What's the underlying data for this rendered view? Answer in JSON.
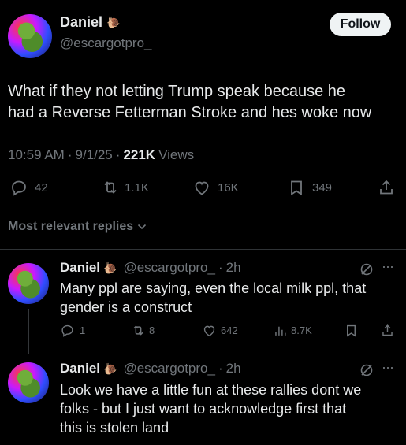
{
  "main_post": {
    "author": {
      "name": "Daniel",
      "badge_icon": "snail-emoji",
      "handle": "@escargotpro_"
    },
    "follow_label": "Follow",
    "text_line1": "What if they not letting Trump speak because he",
    "text_line2": "had a Reverse Fetterman Stroke and hes woke now",
    "meta": {
      "time": "10:59 AM",
      "date": "9/1/25",
      "views_count": "221K",
      "views_label": "Views"
    },
    "actions": {
      "replies": "42",
      "reposts": "1.1K",
      "likes": "16K",
      "bookmarks": "349"
    }
  },
  "sort": {
    "label": "Most relevant replies"
  },
  "replies": [
    {
      "name": "Daniel",
      "handle": "@escargotpro_",
      "dot": "·",
      "time": "2h",
      "line1": "Many ppl are saying, even the local milk ppl, that",
      "line2": "gender is a construct",
      "replies": "1",
      "reposts": "8",
      "likes": "642",
      "views": "8.7K"
    },
    {
      "name": "Daniel",
      "handle": "@escargotpro_",
      "dot": "·",
      "time": "2h",
      "line1": "Look we have a little fun at these rallies dont we",
      "line2": "folks - but I just want to acknowledge first that",
      "line3": "this is stolen land"
    }
  ],
  "colors": {
    "background": "#000000",
    "text": "#e7e9ea",
    "muted": "#71767b",
    "follow_bg": "#eff3f4"
  }
}
